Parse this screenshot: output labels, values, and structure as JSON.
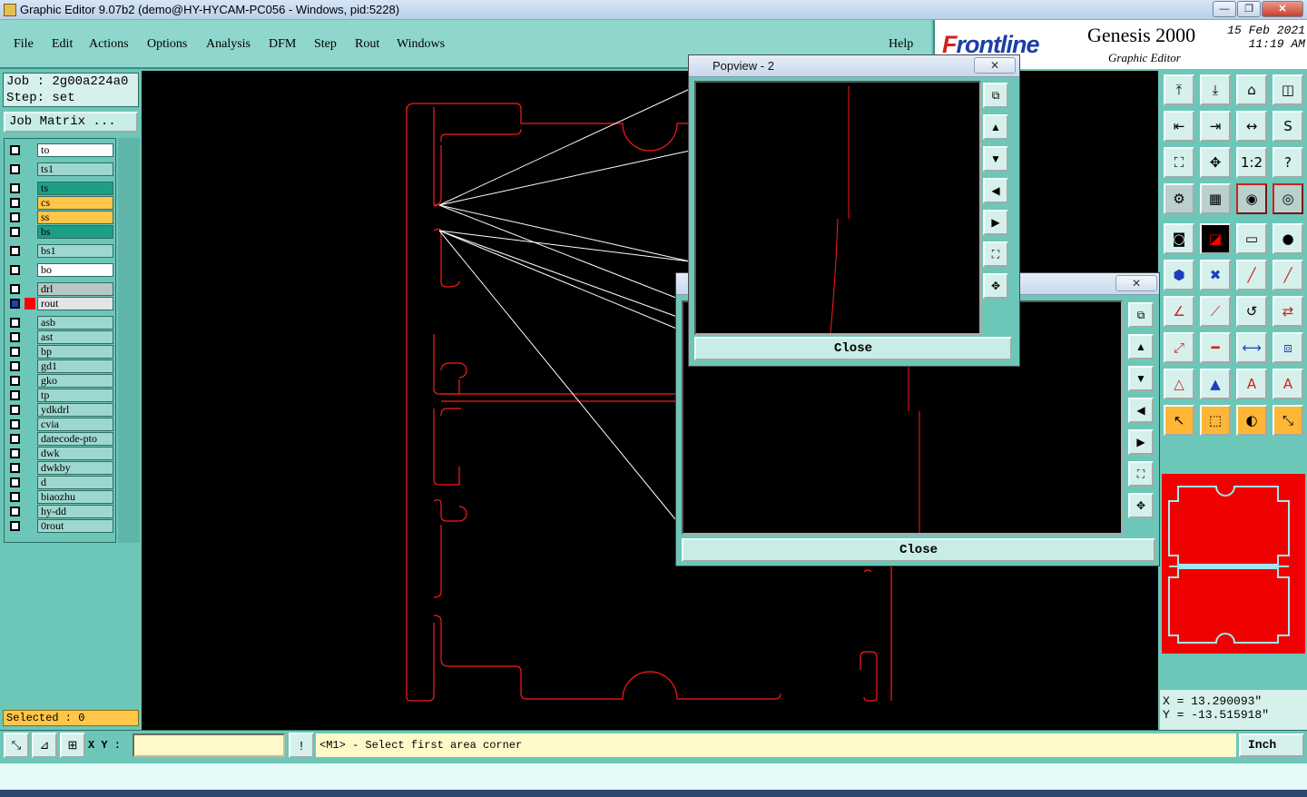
{
  "window": {
    "title": "Graphic Editor 9.07b2 (demo@HY-HYCAM-PC056 - Windows, pid:5228)",
    "min_label": "—",
    "max_label": "❐",
    "close_label": "✕"
  },
  "menu": {
    "items": [
      "File",
      "Edit",
      "Actions",
      "Options",
      "Analysis",
      "DFM",
      "Step",
      "Rout",
      "Windows"
    ],
    "help": "Help"
  },
  "brand": {
    "logo_prefix": "F",
    "logo_rest": "rontline",
    "product": "Genesis 2000",
    "subtitle": "Graphic Editor",
    "date": "15 Feb 2021",
    "time": "11:19 AM"
  },
  "job": {
    "job_line": "Job : 2g00a224a0",
    "step_line": "Step: set",
    "matrix_button": "Job Matrix ..."
  },
  "layers": [
    {
      "name": "to",
      "color": "#ffffff"
    },
    {
      "name": "ts1",
      "color": "#9ed7cf"
    },
    {
      "name": "ts",
      "color": "#1d9f83"
    },
    {
      "name": "cs",
      "color": "#ffc64a"
    },
    {
      "name": "ss",
      "color": "#ffc64a"
    },
    {
      "name": "bs",
      "color": "#1d9f83"
    },
    {
      "name": "bs1",
      "color": "#9ed7cf"
    },
    {
      "name": "bo",
      "color": "#ffffff"
    },
    {
      "name": "drl",
      "color": "#b9c6c4"
    },
    {
      "name": "rout",
      "color": "#e4e4e4"
    },
    {
      "name": "asb",
      "color": "#9ed7cf"
    },
    {
      "name": "ast",
      "color": "#9ed7cf"
    },
    {
      "name": "bp",
      "color": "#9ed7cf"
    },
    {
      "name": "gd1",
      "color": "#9ed7cf"
    },
    {
      "name": "gko",
      "color": "#9ed7cf"
    },
    {
      "name": "tp",
      "color": "#9ed7cf"
    },
    {
      "name": "ydkdrl",
      "color": "#9ed7cf"
    },
    {
      "name": "cvia",
      "color": "#9ed7cf"
    },
    {
      "name": "datecode-pto",
      "color": "#9ed7cf"
    },
    {
      "name": "dwk",
      "color": "#9ed7cf"
    },
    {
      "name": "dwkby",
      "color": "#9ed7cf"
    },
    {
      "name": "d",
      "color": "#9ed7cf"
    },
    {
      "name": "biaozhu",
      "color": "#9ed7cf"
    },
    {
      "name": "hy-dd",
      "color": "#9ed7cf"
    },
    {
      "name": "0rout",
      "color": "#9ed7cf"
    }
  ],
  "selected_label": "Selected : 0",
  "popview1": {
    "title": "Popview - 2",
    "close": "Close",
    "x_label": "✕"
  },
  "popview2": {
    "title": "",
    "close": "Close",
    "x_label": "✕"
  },
  "coords": {
    "x": "X = 13.290093\"",
    "y": "Y = -13.515918\""
  },
  "status": {
    "xy_label": "X Y :",
    "xy_value": "",
    "message": "<M1> - Select first area corner",
    "unit": "Inch"
  },
  "colors": {
    "route": "#ff1a1a",
    "canvas_bg": "#000000",
    "panel": "#6cc7b9"
  }
}
